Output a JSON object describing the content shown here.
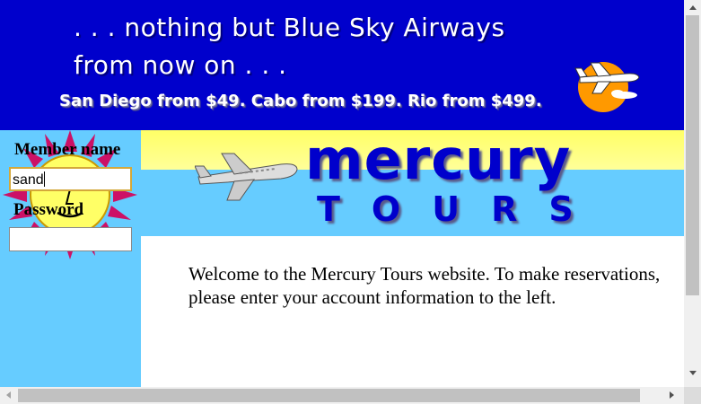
{
  "banner": {
    "line1": ". . . nothing but Blue Sky Airways",
    "line2": "from now on . . .",
    "promo": "San Diego from $49. Cabo from $199. Rio from $499."
  },
  "brand": {
    "name": "mercury",
    "tagline": "TOURS"
  },
  "login": {
    "member_label": "Member name",
    "member_value": "sand",
    "password_label": "Password",
    "password_value": ""
  },
  "main": {
    "welcome": "Welcome to the Mercury Tours website. To make reservations, please enter your account information to the left."
  },
  "colors": {
    "banner_bg": "#0000cc",
    "sky": "#66ccff",
    "header_yellow": "#ffff66",
    "brand_blue": "#0000cc",
    "sun_orange": "#ff9900"
  },
  "icons": {
    "banner": "airplane-sun-icon",
    "header": "airplane-icon",
    "logo": "sun-face-icon"
  }
}
